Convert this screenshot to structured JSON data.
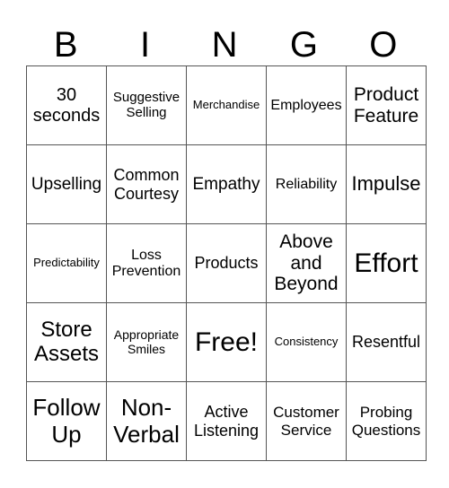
{
  "header": [
    "B",
    "I",
    "N",
    "G",
    "O"
  ],
  "rows": [
    [
      "30 seconds",
      "Suggestive Selling",
      "Merchandise",
      "Employees",
      "Product Feature"
    ],
    [
      "Upselling",
      "Common Courtesy",
      "Empathy",
      "Reliability",
      "Impulse"
    ],
    [
      "Predictability",
      "Loss Prevention",
      "Products",
      "Above and Beyond",
      "Effort"
    ],
    [
      "Store Assets",
      "Appropriate Smiles",
      "Free!",
      "Consistency",
      "Resentful"
    ],
    [
      "Follow Up",
      "Non-Verbal",
      "Active Listening",
      "Customer Service",
      "Probing Questions"
    ]
  ]
}
